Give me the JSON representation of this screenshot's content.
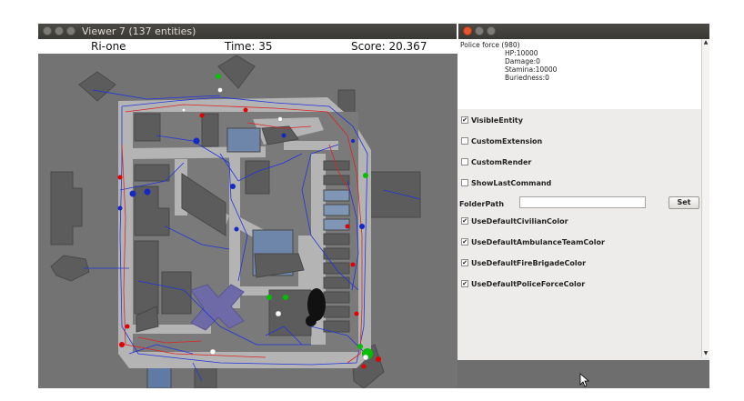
{
  "viewer_window": {
    "title": "Viewer 7 (137 entities)"
  },
  "status": {
    "team": "Ri-one",
    "time": "Time: 35",
    "score": "Score: 20.367"
  },
  "info": {
    "entity": "Police force (980)",
    "hp": "HP:10000",
    "damage": "Damage:0",
    "stamina": "Stamina:10000",
    "buriedness": "Buriedness:0"
  },
  "options": [
    {
      "label": "VisibleEntity",
      "checked": true
    },
    {
      "label": "CustomExtension",
      "checked": false
    },
    {
      "label": "CustomRender",
      "checked": false
    },
    {
      "label": "ShowLastCommand",
      "checked": false
    }
  ],
  "folder": {
    "label": "FolderPath",
    "value": "",
    "button": "Set"
  },
  "color_options": [
    {
      "label": "UseDefaultCivilianColor",
      "checked": true
    },
    {
      "label": "UseDefaultAmbulanceTeamColor",
      "checked": true
    },
    {
      "label": "UseDefaultFireBrigadeColor",
      "checked": true
    },
    {
      "label": "UseDefaultPoliceForceColor",
      "checked": true
    }
  ],
  "colors": {
    "background": "#737373",
    "road": "#b4b4b4",
    "building": "#5c5c5c",
    "building_selected": "#7f96b6",
    "refuge": "#6e6aa8",
    "civilian": "#00c000",
    "fire_brigade": "#e00000",
    "police": "#1428c8",
    "ambulance": "#ffffff"
  }
}
